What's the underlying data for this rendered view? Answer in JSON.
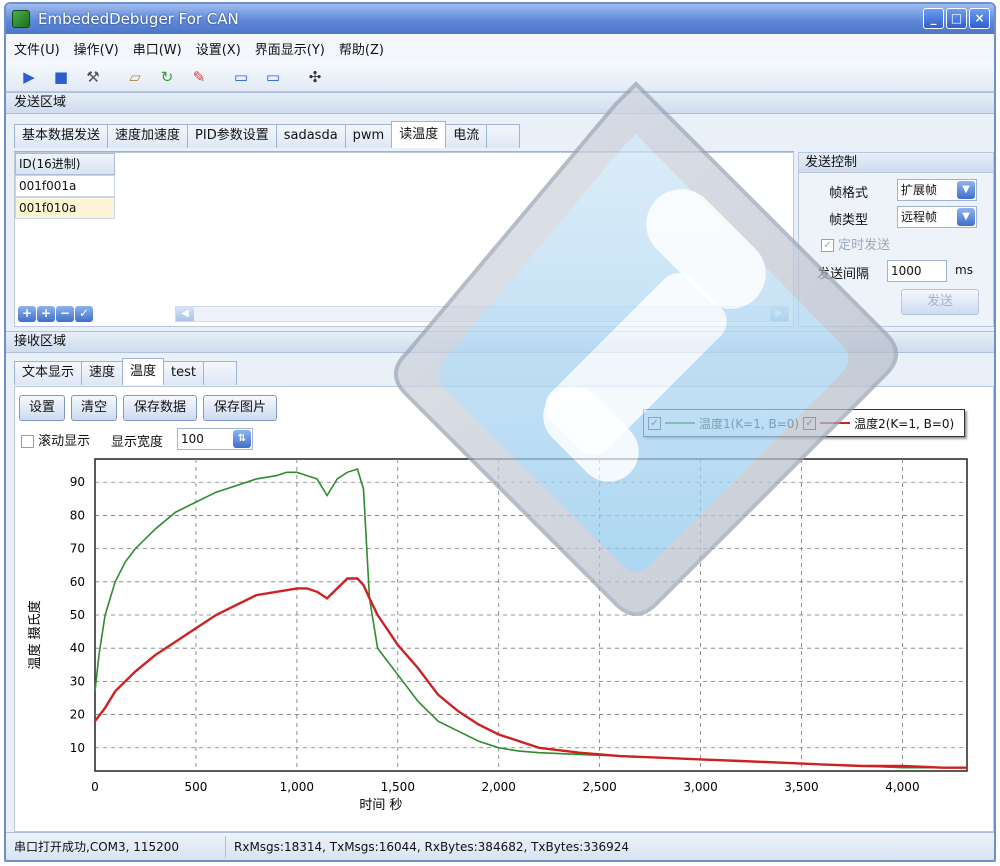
{
  "window": {
    "title": "EmbededDebuger For CAN",
    "btn_min": "_",
    "btn_max": "□",
    "btn_close": "×"
  },
  "menu": [
    "文件(U)",
    "操作(V)",
    "串口(W)",
    "设置(X)",
    "界面显示(Y)",
    "帮助(Z)"
  ],
  "toolbar": {
    "icons": [
      "play-icon",
      "stop-icon",
      "hammer-icon",
      "page-icon",
      "refresh-icon",
      "pencil-icon",
      "layout-top-icon",
      "layout-bottom-icon",
      "usb-icon"
    ],
    "glyphs": [
      "▶",
      "■",
      "⚒",
      "▱",
      "↻",
      "✎",
      "▭",
      "▭",
      "✣"
    ]
  },
  "send": {
    "section_title": "发送区域",
    "tabs": [
      "基本数据发送",
      "速度加速度",
      "PID参数设置",
      "sadasda",
      "pwm",
      "读温度",
      "电流"
    ],
    "active_tab": 5,
    "grid_header": "ID(16进制)",
    "rows": [
      "001f001a",
      "001f010a"
    ],
    "mini_buttons": [
      "+",
      "+",
      "−",
      "✓"
    ]
  },
  "control": {
    "title": "发送控制",
    "frame_format_label": "帧格式",
    "frame_format_value": "扩展帧",
    "frame_type_label": "帧类型",
    "frame_type_value": "远程帧",
    "timed_send_label": "定时发送",
    "timed_send_checked": true,
    "interval_label": "发送间隔",
    "interval_value": "1000",
    "interval_unit": "ms",
    "send_button": "发送"
  },
  "receive": {
    "section_title": "接收区域",
    "tabs": [
      "文本显示",
      "速度",
      "温度",
      "test"
    ],
    "active_tab": 2,
    "buttons": [
      "设置",
      "清空",
      "保存数据",
      "保存图片"
    ],
    "scroll_label": "滚动显示",
    "scroll_checked": false,
    "width_label": "显示宽度",
    "width_value": "100"
  },
  "status": {
    "port": "串口打开成功,COM3, 115200",
    "stats": "RxMsgs:18314, TxMsgs:16044, RxBytes:384682, TxBytes:336924"
  },
  "colors": {
    "series1": "#2e8b2e",
    "series2": "#cc2222",
    "titlebar": "#5f88d8"
  },
  "chart_data": {
    "type": "line",
    "title": "",
    "xlabel": "时间  秒",
    "ylabel": "温度  摄氏度",
    "xlim": [
      0,
      4320
    ],
    "ylim": [
      3,
      97
    ],
    "xticks": [
      0,
      500,
      1000,
      1500,
      2000,
      2500,
      3000,
      3500,
      4000
    ],
    "xtick_labels": [
      "0",
      "500",
      "1,000",
      "1,500",
      "2,000",
      "2,500",
      "3,000",
      "3,500",
      "4,000"
    ],
    "yticks": [
      10,
      20,
      30,
      40,
      50,
      60,
      70,
      80,
      90
    ],
    "grid": true,
    "legend_position": "top-right",
    "series": [
      {
        "name": "温度1(K=1, B=0)",
        "x": [
          0,
          20,
          50,
          100,
          150,
          200,
          300,
          400,
          500,
          600,
          700,
          800,
          900,
          950,
          1000,
          1050,
          1100,
          1150,
          1200,
          1250,
          1300,
          1330,
          1360,
          1400,
          1450,
          1500,
          1600,
          1700,
          1800,
          1900,
          2000,
          2100,
          2200,
          2400,
          2600,
          2800,
          3000,
          3200,
          3400,
          3600,
          3800,
          4000,
          4200,
          4320
        ],
        "y": [
          27,
          38,
          50,
          60,
          66,
          70,
          76,
          81,
          84,
          87,
          89,
          91,
          92,
          93,
          93,
          92,
          91,
          86,
          91,
          93,
          94,
          88,
          55,
          40,
          36,
          32,
          24,
          18,
          15,
          12,
          10,
          9,
          8.5,
          8,
          7.5,
          7,
          6.5,
          6,
          5.5,
          5,
          4.5,
          4,
          4,
          4
        ]
      },
      {
        "name": "温度2(K=1, B=0)",
        "x": [
          0,
          50,
          100,
          200,
          300,
          400,
          500,
          600,
          700,
          800,
          900,
          1000,
          1050,
          1100,
          1150,
          1200,
          1250,
          1300,
          1330,
          1360,
          1400,
          1500,
          1600,
          1700,
          1800,
          1900,
          2000,
          2100,
          2200,
          2400,
          2600,
          2800,
          3000,
          3200,
          3400,
          3600,
          3800,
          4000,
          4200,
          4320
        ],
        "y": [
          18,
          22,
          27,
          33,
          38,
          42,
          46,
          50,
          53,
          56,
          57,
          58,
          58,
          57,
          55,
          58,
          61,
          61,
          59,
          55,
          50,
          41,
          34,
          26,
          21,
          17,
          14,
          12,
          10,
          8.5,
          7.5,
          7,
          6.5,
          6,
          5.5,
          5,
          4.5,
          4.5,
          4,
          4
        ]
      }
    ]
  }
}
